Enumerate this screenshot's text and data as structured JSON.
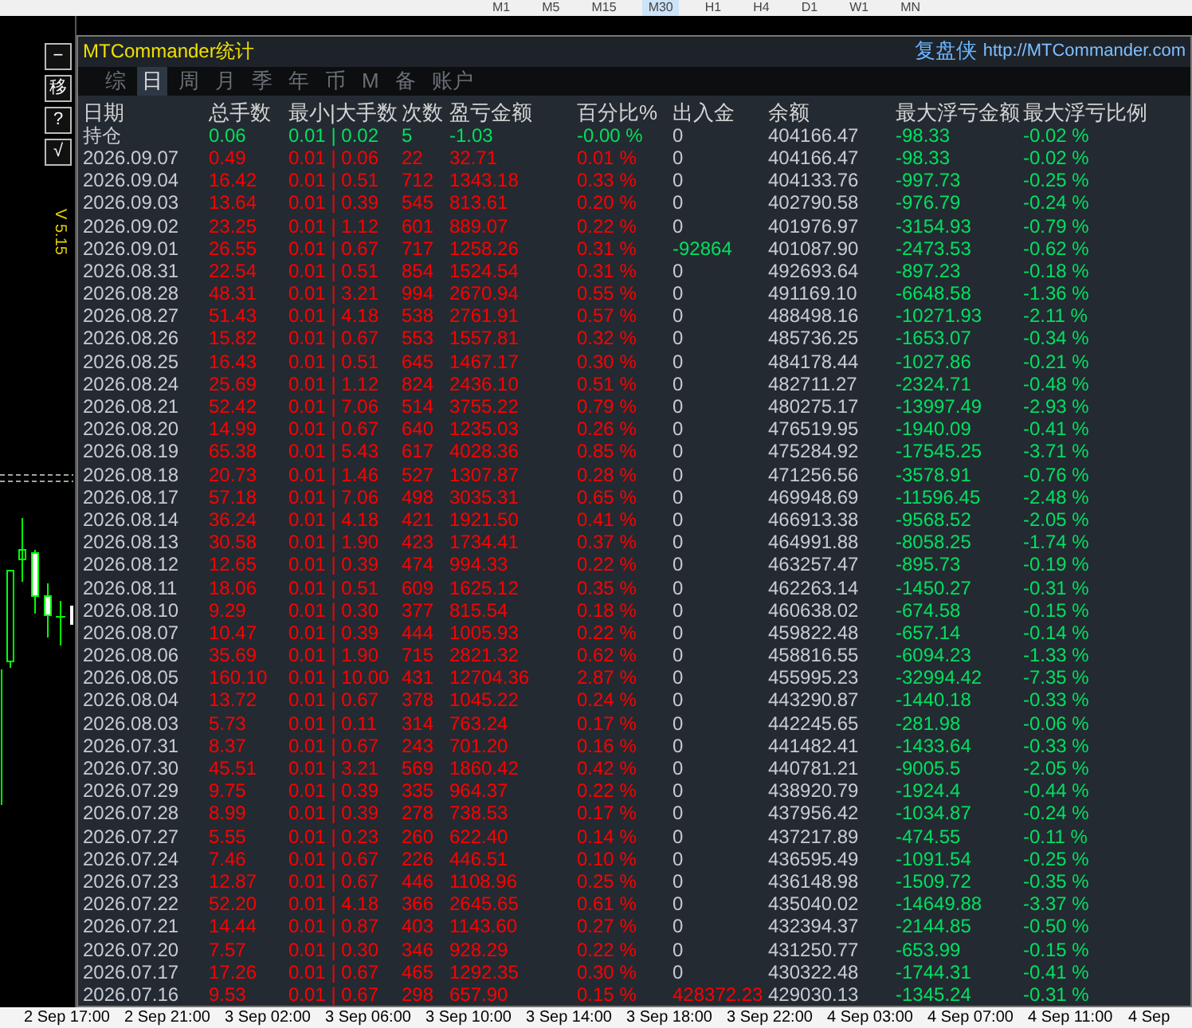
{
  "toolbar": {
    "timeframes": [
      {
        "label": "M1",
        "selected": false
      },
      {
        "label": "M5",
        "selected": false
      },
      {
        "label": "M15",
        "selected": false
      },
      {
        "label": "M30",
        "selected": true
      },
      {
        "label": "H1",
        "selected": false
      },
      {
        "label": "H4",
        "selected": false
      },
      {
        "label": "D1",
        "selected": false
      },
      {
        "label": "W1",
        "selected": false
      },
      {
        "label": "MN",
        "selected": false
      }
    ]
  },
  "side_buttons": [
    "−",
    "移",
    "?",
    "√"
  ],
  "version": "V 5.15",
  "panel": {
    "title": "MTCommander统计",
    "brand": "复盘侠",
    "url": "http://MTCommander.com",
    "tabs": [
      {
        "label": "综",
        "selected": false
      },
      {
        "label": "日",
        "selected": true
      },
      {
        "label": "周",
        "selected": false
      },
      {
        "label": "月",
        "selected": false
      },
      {
        "label": "季",
        "selected": false
      },
      {
        "label": "年",
        "selected": false
      },
      {
        "label": "币",
        "selected": false
      },
      {
        "label": "M",
        "selected": false
      },
      {
        "label": "备",
        "selected": false
      },
      {
        "label": "账户",
        "selected": false
      }
    ],
    "columns": [
      "日期",
      "总手数",
      "最小|大手数",
      "次数",
      "盈亏金额",
      "百分比%",
      "出入金",
      "余额",
      "最大浮亏金额",
      "最大浮亏比例"
    ],
    "rows": [
      {
        "date": "持仓",
        "lots": "0.06",
        "min_max": "0.01 | 0.02",
        "count": "5",
        "pnl": "-1.03",
        "pct": "-0.00 %",
        "color": "#00e060",
        "deposit": {
          "text": "0",
          "color": "#c8ccd2"
        },
        "balance": "404166.47",
        "max_dd": "-98.33",
        "max_dd_pct": "-0.02 %"
      },
      {
        "date": "2026.09.07",
        "lots": "0.49",
        "min_max": "0.01 | 0.06",
        "count": "22",
        "pnl": "32.71",
        "pct": "0.01 %",
        "color": "#ff0000",
        "deposit": {
          "text": "0",
          "color": "#c8ccd2"
        },
        "balance": "404166.47",
        "max_dd": "-98.33",
        "max_dd_pct": "-0.02 %"
      },
      {
        "date": "2026.09.04",
        "lots": "16.42",
        "min_max": "0.01 | 0.51",
        "count": "712",
        "pnl": "1343.18",
        "pct": "0.33 %",
        "color": "#ff0000",
        "deposit": {
          "text": "0",
          "color": "#c8ccd2"
        },
        "balance": "404133.76",
        "max_dd": "-997.73",
        "max_dd_pct": "-0.25 %"
      },
      {
        "date": "2026.09.03",
        "lots": "13.64",
        "min_max": "0.01 | 0.39",
        "count": "545",
        "pnl": "813.61",
        "pct": "0.20 %",
        "color": "#ff0000",
        "deposit": {
          "text": "0",
          "color": "#c8ccd2"
        },
        "balance": "402790.58",
        "max_dd": "-976.79",
        "max_dd_pct": "-0.24 %"
      },
      {
        "date": "2026.09.02",
        "lots": "23.25",
        "min_max": "0.01 | 1.12",
        "count": "601",
        "pnl": "889.07",
        "pct": "0.22 %",
        "color": "#ff0000",
        "deposit": {
          "text": "0",
          "color": "#c8ccd2"
        },
        "balance": "401976.97",
        "max_dd": "-3154.93",
        "max_dd_pct": "-0.79 %"
      },
      {
        "date": "2026.09.01",
        "lots": "26.55",
        "min_max": "0.01 | 0.67",
        "count": "717",
        "pnl": "1258.26",
        "pct": "0.31 %",
        "color": "#ff0000",
        "deposit": {
          "text": "-92864",
          "color": "#00e060"
        },
        "balance": "401087.90",
        "max_dd": "-2473.53",
        "max_dd_pct": "-0.62 %"
      },
      {
        "date": "2026.08.31",
        "lots": "22.54",
        "min_max": "0.01 | 0.51",
        "count": "854",
        "pnl": "1524.54",
        "pct": "0.31 %",
        "color": "#ff0000",
        "deposit": {
          "text": "0",
          "color": "#c8ccd2"
        },
        "balance": "492693.64",
        "max_dd": "-897.23",
        "max_dd_pct": "-0.18 %"
      },
      {
        "date": "2026.08.28",
        "lots": "48.31",
        "min_max": "0.01 | 3.21",
        "count": "994",
        "pnl": "2670.94",
        "pct": "0.55 %",
        "color": "#ff0000",
        "deposit": {
          "text": "0",
          "color": "#c8ccd2"
        },
        "balance": "491169.10",
        "max_dd": "-6648.58",
        "max_dd_pct": "-1.36 %"
      },
      {
        "date": "2026.08.27",
        "lots": "51.43",
        "min_max": "0.01 | 4.18",
        "count": "538",
        "pnl": "2761.91",
        "pct": "0.57 %",
        "color": "#ff0000",
        "deposit": {
          "text": "0",
          "color": "#c8ccd2"
        },
        "balance": "488498.16",
        "max_dd": "-10271.93",
        "max_dd_pct": "-2.11 %"
      },
      {
        "date": "2026.08.26",
        "lots": "15.82",
        "min_max": "0.01 | 0.67",
        "count": "553",
        "pnl": "1557.81",
        "pct": "0.32 %",
        "color": "#ff0000",
        "deposit": {
          "text": "0",
          "color": "#c8ccd2"
        },
        "balance": "485736.25",
        "max_dd": "-1653.07",
        "max_dd_pct": "-0.34 %"
      },
      {
        "date": "2026.08.25",
        "lots": "16.43",
        "min_max": "0.01 | 0.51",
        "count": "645",
        "pnl": "1467.17",
        "pct": "0.30 %",
        "color": "#ff0000",
        "deposit": {
          "text": "0",
          "color": "#c8ccd2"
        },
        "balance": "484178.44",
        "max_dd": "-1027.86",
        "max_dd_pct": "-0.21 %"
      },
      {
        "date": "2026.08.24",
        "lots": "25.69",
        "min_max": "0.01 | 1.12",
        "count": "824",
        "pnl": "2436.10",
        "pct": "0.51 %",
        "color": "#ff0000",
        "deposit": {
          "text": "0",
          "color": "#c8ccd2"
        },
        "balance": "482711.27",
        "max_dd": "-2324.71",
        "max_dd_pct": "-0.48 %"
      },
      {
        "date": "2026.08.21",
        "lots": "52.42",
        "min_max": "0.01 | 7.06",
        "count": "514",
        "pnl": "3755.22",
        "pct": "0.79 %",
        "color": "#ff0000",
        "deposit": {
          "text": "0",
          "color": "#c8ccd2"
        },
        "balance": "480275.17",
        "max_dd": "-13997.49",
        "max_dd_pct": "-2.93 %"
      },
      {
        "date": "2026.08.20",
        "lots": "14.99",
        "min_max": "0.01 | 0.67",
        "count": "640",
        "pnl": "1235.03",
        "pct": "0.26 %",
        "color": "#ff0000",
        "deposit": {
          "text": "0",
          "color": "#c8ccd2"
        },
        "balance": "476519.95",
        "max_dd": "-1940.09",
        "max_dd_pct": "-0.41 %"
      },
      {
        "date": "2026.08.19",
        "lots": "65.38",
        "min_max": "0.01 | 5.43",
        "count": "617",
        "pnl": "4028.36",
        "pct": "0.85 %",
        "color": "#ff0000",
        "deposit": {
          "text": "0",
          "color": "#c8ccd2"
        },
        "balance": "475284.92",
        "max_dd": "-17545.25",
        "max_dd_pct": "-3.71 %"
      },
      {
        "date": "2026.08.18",
        "lots": "20.73",
        "min_max": "0.01 | 1.46",
        "count": "527",
        "pnl": "1307.87",
        "pct": "0.28 %",
        "color": "#ff0000",
        "deposit": {
          "text": "0",
          "color": "#c8ccd2"
        },
        "balance": "471256.56",
        "max_dd": "-3578.91",
        "max_dd_pct": "-0.76 %"
      },
      {
        "date": "2026.08.17",
        "lots": "57.18",
        "min_max": "0.01 | 7.06",
        "count": "498",
        "pnl": "3035.31",
        "pct": "0.65 %",
        "color": "#ff0000",
        "deposit": {
          "text": "0",
          "color": "#c8ccd2"
        },
        "balance": "469948.69",
        "max_dd": "-11596.45",
        "max_dd_pct": "-2.48 %"
      },
      {
        "date": "2026.08.14",
        "lots": "36.24",
        "min_max": "0.01 | 4.18",
        "count": "421",
        "pnl": "1921.50",
        "pct": "0.41 %",
        "color": "#ff0000",
        "deposit": {
          "text": "0",
          "color": "#c8ccd2"
        },
        "balance": "466913.38",
        "max_dd": "-9568.52",
        "max_dd_pct": "-2.05 %"
      },
      {
        "date": "2026.08.13",
        "lots": "30.58",
        "min_max": "0.01 | 1.90",
        "count": "423",
        "pnl": "1734.41",
        "pct": "0.37 %",
        "color": "#ff0000",
        "deposit": {
          "text": "0",
          "color": "#c8ccd2"
        },
        "balance": "464991.88",
        "max_dd": "-8058.25",
        "max_dd_pct": "-1.74 %"
      },
      {
        "date": "2026.08.12",
        "lots": "12.65",
        "min_max": "0.01 | 0.39",
        "count": "474",
        "pnl": "994.33",
        "pct": "0.22 %",
        "color": "#ff0000",
        "deposit": {
          "text": "0",
          "color": "#c8ccd2"
        },
        "balance": "463257.47",
        "max_dd": "-895.73",
        "max_dd_pct": "-0.19 %"
      },
      {
        "date": "2026.08.11",
        "lots": "18.06",
        "min_max": "0.01 | 0.51",
        "count": "609",
        "pnl": "1625.12",
        "pct": "0.35 %",
        "color": "#ff0000",
        "deposit": {
          "text": "0",
          "color": "#c8ccd2"
        },
        "balance": "462263.14",
        "max_dd": "-1450.27",
        "max_dd_pct": "-0.31 %"
      },
      {
        "date": "2026.08.10",
        "lots": "9.29",
        "min_max": "0.01 | 0.30",
        "count": "377",
        "pnl": "815.54",
        "pct": "0.18 %",
        "color": "#ff0000",
        "deposit": {
          "text": "0",
          "color": "#c8ccd2"
        },
        "balance": "460638.02",
        "max_dd": "-674.58",
        "max_dd_pct": "-0.15 %"
      },
      {
        "date": "2026.08.07",
        "lots": "10.47",
        "min_max": "0.01 | 0.39",
        "count": "444",
        "pnl": "1005.93",
        "pct": "0.22 %",
        "color": "#ff0000",
        "deposit": {
          "text": "0",
          "color": "#c8ccd2"
        },
        "balance": "459822.48",
        "max_dd": "-657.14",
        "max_dd_pct": "-0.14 %"
      },
      {
        "date": "2026.08.06",
        "lots": "35.69",
        "min_max": "0.01 | 1.90",
        "count": "715",
        "pnl": "2821.32",
        "pct": "0.62 %",
        "color": "#ff0000",
        "deposit": {
          "text": "0",
          "color": "#c8ccd2"
        },
        "balance": "458816.55",
        "max_dd": "-6094.23",
        "max_dd_pct": "-1.33 %"
      },
      {
        "date": "2026.08.05",
        "lots": "160.10",
        "min_max": "0.01 | 10.00",
        "count": "431",
        "pnl": "12704.36",
        "pct": "2.87 %",
        "color": "#ff0000",
        "deposit": {
          "text": "0",
          "color": "#c8ccd2"
        },
        "balance": "455995.23",
        "max_dd": "-32994.42",
        "max_dd_pct": "-7.35 %"
      },
      {
        "date": "2026.08.04",
        "lots": "13.72",
        "min_max": "0.01 | 0.67",
        "count": "378",
        "pnl": "1045.22",
        "pct": "0.24 %",
        "color": "#ff0000",
        "deposit": {
          "text": "0",
          "color": "#c8ccd2"
        },
        "balance": "443290.87",
        "max_dd": "-1440.18",
        "max_dd_pct": "-0.33 %"
      },
      {
        "date": "2026.08.03",
        "lots": "5.73",
        "min_max": "0.01 | 0.11",
        "count": "314",
        "pnl": "763.24",
        "pct": "0.17 %",
        "color": "#ff0000",
        "deposit": {
          "text": "0",
          "color": "#c8ccd2"
        },
        "balance": "442245.65",
        "max_dd": "-281.98",
        "max_dd_pct": "-0.06 %"
      },
      {
        "date": "2026.07.31",
        "lots": "8.37",
        "min_max": "0.01 | 0.67",
        "count": "243",
        "pnl": "701.20",
        "pct": "0.16 %",
        "color": "#ff0000",
        "deposit": {
          "text": "0",
          "color": "#c8ccd2"
        },
        "balance": "441482.41",
        "max_dd": "-1433.64",
        "max_dd_pct": "-0.33 %"
      },
      {
        "date": "2026.07.30",
        "lots": "45.51",
        "min_max": "0.01 | 3.21",
        "count": "569",
        "pnl": "1860.42",
        "pct": "0.42 %",
        "color": "#ff0000",
        "deposit": {
          "text": "0",
          "color": "#c8ccd2"
        },
        "balance": "440781.21",
        "max_dd": "-9005.5",
        "max_dd_pct": "-2.05 %"
      },
      {
        "date": "2026.07.29",
        "lots": "9.75",
        "min_max": "0.01 | 0.39",
        "count": "335",
        "pnl": "964.37",
        "pct": "0.22 %",
        "color": "#ff0000",
        "deposit": {
          "text": "0",
          "color": "#c8ccd2"
        },
        "balance": "438920.79",
        "max_dd": "-1924.4",
        "max_dd_pct": "-0.44 %"
      },
      {
        "date": "2026.07.28",
        "lots": "8.99",
        "min_max": "0.01 | 0.39",
        "count": "278",
        "pnl": "738.53",
        "pct": "0.17 %",
        "color": "#ff0000",
        "deposit": {
          "text": "0",
          "color": "#c8ccd2"
        },
        "balance": "437956.42",
        "max_dd": "-1034.87",
        "max_dd_pct": "-0.24 %"
      },
      {
        "date": "2026.07.27",
        "lots": "5.55",
        "min_max": "0.01 | 0.23",
        "count": "260",
        "pnl": "622.40",
        "pct": "0.14 %",
        "color": "#ff0000",
        "deposit": {
          "text": "0",
          "color": "#c8ccd2"
        },
        "balance": "437217.89",
        "max_dd": "-474.55",
        "max_dd_pct": "-0.11 %"
      },
      {
        "date": "2026.07.24",
        "lots": "7.46",
        "min_max": "0.01 | 0.67",
        "count": "226",
        "pnl": "446.51",
        "pct": "0.10 %",
        "color": "#ff0000",
        "deposit": {
          "text": "0",
          "color": "#c8ccd2"
        },
        "balance": "436595.49",
        "max_dd": "-1091.54",
        "max_dd_pct": "-0.25 %"
      },
      {
        "date": "2026.07.23",
        "lots": "12.87",
        "min_max": "0.01 | 0.67",
        "count": "446",
        "pnl": "1108.96",
        "pct": "0.25 %",
        "color": "#ff0000",
        "deposit": {
          "text": "0",
          "color": "#c8ccd2"
        },
        "balance": "436148.98",
        "max_dd": "-1509.72",
        "max_dd_pct": "-0.35 %"
      },
      {
        "date": "2026.07.22",
        "lots": "52.20",
        "min_max": "0.01 | 4.18",
        "count": "366",
        "pnl": "2645.65",
        "pct": "0.61 %",
        "color": "#ff0000",
        "deposit": {
          "text": "0",
          "color": "#c8ccd2"
        },
        "balance": "435040.02",
        "max_dd": "-14649.88",
        "max_dd_pct": "-3.37 %"
      },
      {
        "date": "2026.07.21",
        "lots": "14.44",
        "min_max": "0.01 | 0.87",
        "count": "403",
        "pnl": "1143.60",
        "pct": "0.27 %",
        "color": "#ff0000",
        "deposit": {
          "text": "0",
          "color": "#c8ccd2"
        },
        "balance": "432394.37",
        "max_dd": "-2144.85",
        "max_dd_pct": "-0.50 %"
      },
      {
        "date": "2026.07.20",
        "lots": "7.57",
        "min_max": "0.01 | 0.30",
        "count": "346",
        "pnl": "928.29",
        "pct": "0.22 %",
        "color": "#ff0000",
        "deposit": {
          "text": "0",
          "color": "#c8ccd2"
        },
        "balance": "431250.77",
        "max_dd": "-653.99",
        "max_dd_pct": "-0.15 %"
      },
      {
        "date": "2026.07.17",
        "lots": "17.26",
        "min_max": "0.01 | 0.67",
        "count": "465",
        "pnl": "1292.35",
        "pct": "0.30 %",
        "color": "#ff0000",
        "deposit": {
          "text": "0",
          "color": "#c8ccd2"
        },
        "balance": "430322.48",
        "max_dd": "-1744.31",
        "max_dd_pct": "-0.41 %"
      },
      {
        "date": "2026.07.16",
        "lots": "9.53",
        "min_max": "0.01 | 0.67",
        "count": "298",
        "pnl": "657.90",
        "pct": "0.15 %",
        "color": "#ff0000",
        "deposit": {
          "text": "428372.23",
          "color": "#ff0000"
        },
        "balance": "429030.13",
        "max_dd": "-1345.24",
        "max_dd_pct": "-0.31 %"
      }
    ]
  },
  "time_axis": [
    "2 Sep 17:00",
    "2 Sep 21:00",
    "3 Sep 02:00",
    "3 Sep 06:00",
    "3 Sep 10:00",
    "3 Sep 14:00",
    "3 Sep 18:00",
    "3 Sep 22:00",
    "4 Sep 03:00",
    "4 Sep 07:00",
    "4 Sep 11:00",
    "4 Sep"
  ]
}
